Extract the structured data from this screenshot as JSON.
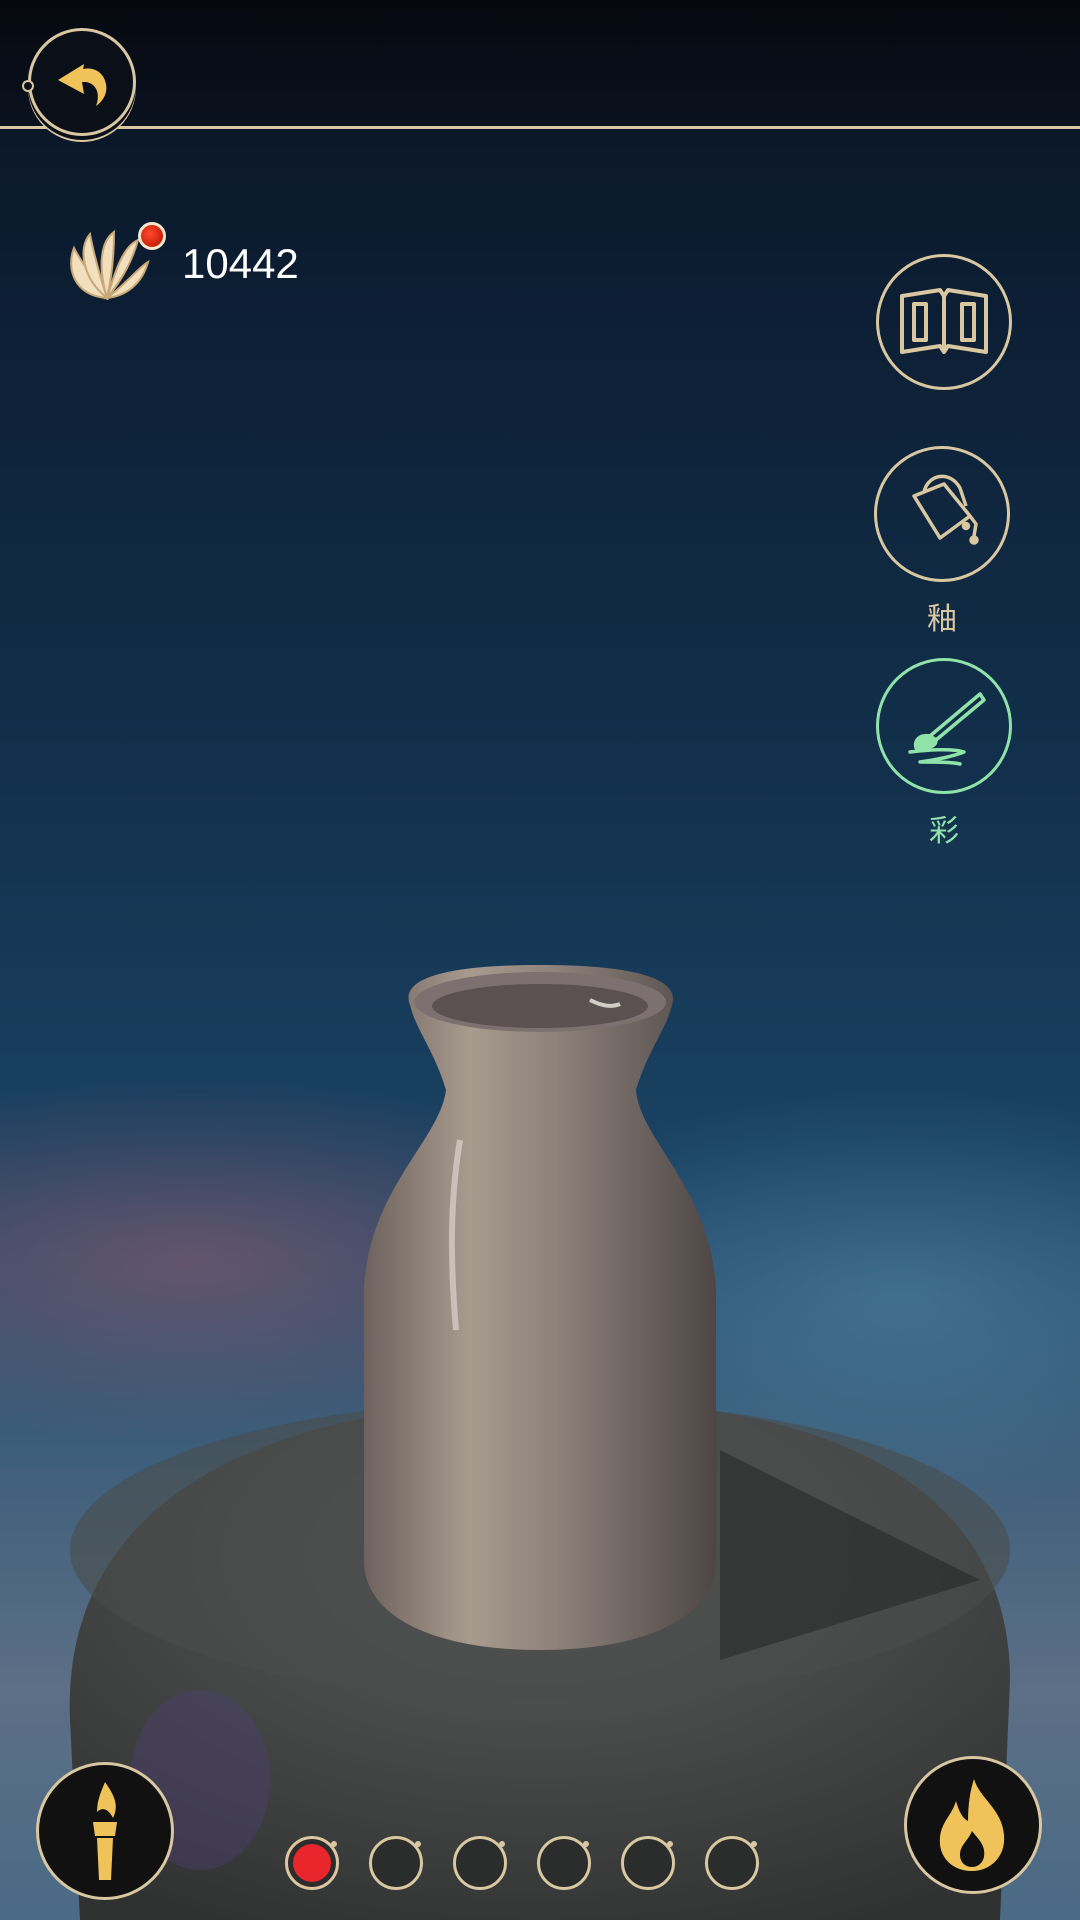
{
  "header": {
    "back_icon": "curved-back-arrow-icon"
  },
  "currency": {
    "icon": "shell-icon",
    "value": "10442",
    "notification": "red-dot"
  },
  "side_tools": [
    {
      "id": "catalog",
      "icon": "book-icon",
      "label": "",
      "color": "#d8c7a1"
    },
    {
      "id": "glaze",
      "icon": "glaze-bucket-icon",
      "label": "釉",
      "color": "#d8c7a1"
    },
    {
      "id": "paint",
      "icon": "brush-icon",
      "label": "彩",
      "color": "#8fe3a9",
      "active": true
    }
  ],
  "bottom": {
    "left_icon": "paint-brush-flame-icon",
    "right_icon": "kiln-fire-icon",
    "slots": [
      {
        "filled": true,
        "color": "#e8262c"
      },
      {
        "filled": false
      },
      {
        "filled": false
      },
      {
        "filled": false
      },
      {
        "filled": false
      },
      {
        "filled": false
      }
    ]
  },
  "colors": {
    "accent": "#d8c7a1",
    "active": "#8fe3a9",
    "selected_color": "#e8262c"
  }
}
